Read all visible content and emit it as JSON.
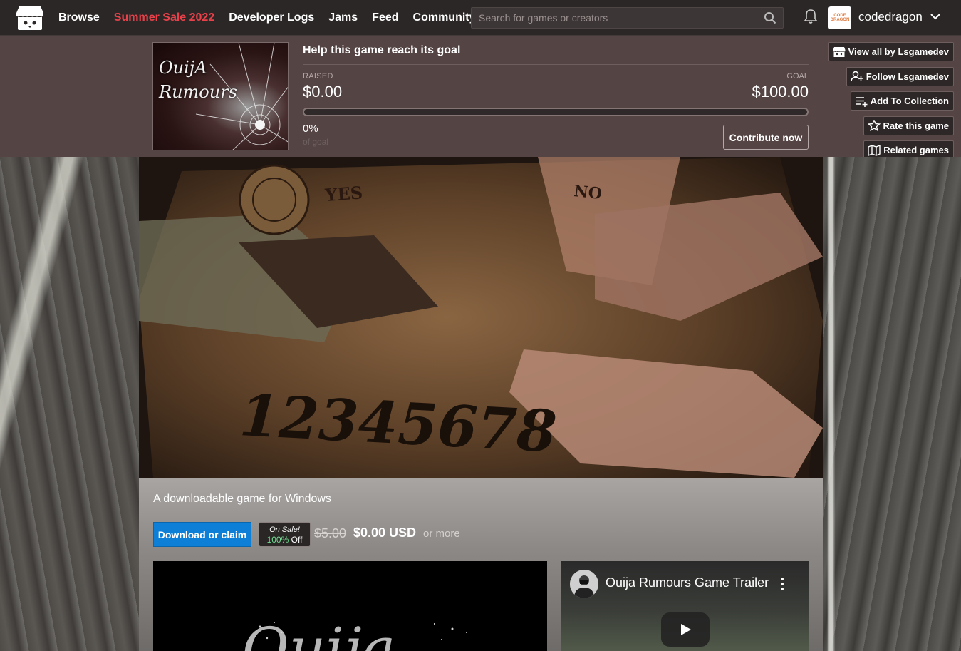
{
  "nav": {
    "links": [
      {
        "label": "Browse"
      },
      {
        "label": "Summer Sale 2022"
      },
      {
        "label": "Developer Logs"
      },
      {
        "label": "Jams"
      },
      {
        "label": "Feed"
      },
      {
        "label": "Community"
      }
    ],
    "search_placeholder": "Search for games or creators",
    "username": "codedragon",
    "avatar_text": "CODE DRAGON"
  },
  "goal": {
    "cover_title_line1": "OuijA",
    "cover_title_line2": "Rumours",
    "heading": "Help this game reach its goal",
    "raised_label": "RAISED",
    "raised_value": "$0.00",
    "goal_label": "GOAL",
    "goal_value": "$100.00",
    "progress_percent": 0,
    "percent_text": "0%",
    "percent_sub": "of goal",
    "contribute_label": "Contribute now"
  },
  "actions": [
    {
      "label": "View all by Lsgamedev",
      "icon": "itchio-icon"
    },
    {
      "label": "Follow Lsgamedev",
      "icon": "follow-user-icon"
    },
    {
      "label": "Add To Collection",
      "icon": "add-collection-icon"
    },
    {
      "label": "Rate this game",
      "icon": "star-icon"
    },
    {
      "label": "Related games",
      "icon": "map-icon"
    }
  ],
  "hero": {
    "board_yes": "YES",
    "board_no": "NO",
    "board_numbers": "12345678"
  },
  "game": {
    "tagline": "A downloadable game for Windows",
    "download_label": "Download or claim",
    "sale_line1": "On Sale!",
    "sale_pct": "100%",
    "sale_off": "Off",
    "price_old": "$5.00",
    "price_new": "$0.00 USD",
    "price_more": "or more"
  },
  "video": {
    "left_title": "Ouija",
    "right_title": "Ouija Rumours Game Trailer"
  },
  "colors": {
    "sale": "#e8414a",
    "download": "#0e7fd6",
    "off_green": "#6fe092",
    "goal_bg": "#554444"
  }
}
